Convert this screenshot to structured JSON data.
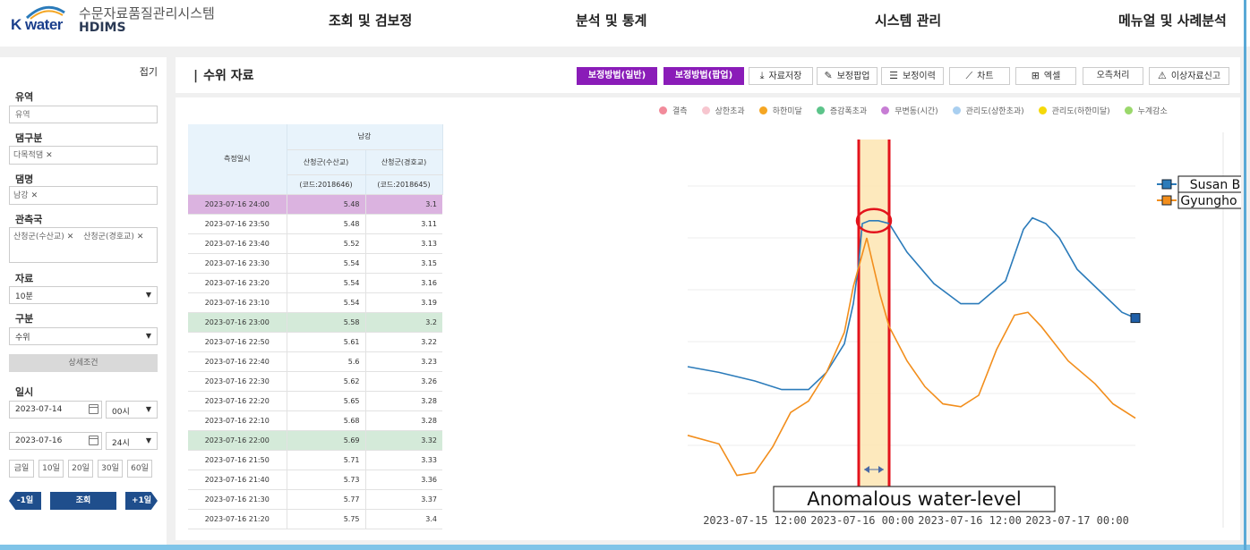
{
  "header": {
    "logo_text": "K water",
    "system_name": "수문자료품질관리시스템",
    "system_abbr": "HDIMS",
    "nav": [
      "조회 및 검보정",
      "분석 및 통계",
      "시스템 관리",
      "메뉴얼 및 사례분석"
    ]
  },
  "sidebar": {
    "fold_label": "접기",
    "basin": {
      "label": "유역",
      "placeholder": "유역"
    },
    "dam_type": {
      "label": "댐구분",
      "tags": [
        "다목적댐"
      ]
    },
    "dam_name": {
      "label": "댐명",
      "tags": [
        "남강"
      ]
    },
    "stations": {
      "label": "관측국",
      "tags": [
        "산청군(수산교)",
        "산청군(경호교)"
      ]
    },
    "data": {
      "label": "자료",
      "value": "10분"
    },
    "category": {
      "label": "구분",
      "value": "수위"
    },
    "detail_button": "상세조건",
    "datetime": {
      "label": "일시",
      "start_date": "2023-07-14",
      "start_hour": "00시",
      "end_date": "2023-07-16",
      "end_hour": "24시"
    },
    "quick": [
      "금일",
      "10일",
      "20일",
      "30일",
      "60일"
    ],
    "prev_day": "-1일",
    "query": "조회",
    "next_day": "+1일"
  },
  "main": {
    "title": "수위 자료",
    "toolbar": [
      {
        "label": "보정방법(일반)",
        "style": "primary",
        "icon": ""
      },
      {
        "label": "보정방법(팝업)",
        "style": "primary",
        "icon": ""
      },
      {
        "label": "자료저장",
        "icon": "download-icon",
        "glyph": "⤓"
      },
      {
        "label": "보정팝업",
        "icon": "edit-icon",
        "glyph": "✎"
      },
      {
        "label": "보정이력",
        "icon": "history-icon",
        "glyph": "☰"
      },
      {
        "label": "차트",
        "icon": "chart-icon",
        "glyph": "⟋"
      },
      {
        "label": "엑셀",
        "icon": "excel-icon",
        "glyph": "⊞"
      },
      {
        "label": "오측처리",
        "icon": "",
        "glyph": ""
      },
      {
        "label": "이상자료신고",
        "icon": "alarm-icon",
        "glyph": "⚠"
      }
    ],
    "legend": [
      {
        "label": "결측",
        "color": "#f28b9b"
      },
      {
        "label": "상한초과",
        "color": "#f7c6cf"
      },
      {
        "label": "하한미달",
        "color": "#f5a623"
      },
      {
        "label": "증감폭초과",
        "color": "#5cc48a"
      },
      {
        "label": "무변동(시간)",
        "color": "#c77dd4"
      },
      {
        "label": "관리도(상한초과)",
        "color": "#a9cff0"
      },
      {
        "label": "관리도(하한미달)",
        "color": "#f5d90a"
      },
      {
        "label": "누계감소",
        "color": "#9ad86b"
      }
    ],
    "table": {
      "col_time": "측정일시",
      "group": "남강",
      "col_a": "산청군(수산교)",
      "col_a_code": "(코드:2018646)",
      "col_b": "산청군(경호교)",
      "col_b_code": "(코드:2018645)",
      "rows": [
        {
          "t": "2023-07-16 24:00",
          "a": "5.48",
          "b": "3.1",
          "flag": "purple"
        },
        {
          "t": "2023-07-16 23:50",
          "a": "5.48",
          "b": "3.11",
          "flag": ""
        },
        {
          "t": "2023-07-16 23:40",
          "a": "5.52",
          "b": "3.13",
          "flag": ""
        },
        {
          "t": "2023-07-16 23:30",
          "a": "5.54",
          "b": "3.15",
          "flag": ""
        },
        {
          "t": "2023-07-16 23:20",
          "a": "5.54",
          "b": "3.16",
          "flag": ""
        },
        {
          "t": "2023-07-16 23:10",
          "a": "5.54",
          "b": "3.19",
          "flag": ""
        },
        {
          "t": "2023-07-16 23:00",
          "a": "5.58",
          "b": "3.2",
          "flag": "green"
        },
        {
          "t": "2023-07-16 22:50",
          "a": "5.61",
          "b": "3.22",
          "flag": ""
        },
        {
          "t": "2023-07-16 22:40",
          "a": "5.6",
          "b": "3.23",
          "flag": ""
        },
        {
          "t": "2023-07-16 22:30",
          "a": "5.62",
          "b": "3.26",
          "flag": ""
        },
        {
          "t": "2023-07-16 22:20",
          "a": "5.65",
          "b": "3.28",
          "flag": ""
        },
        {
          "t": "2023-07-16 22:10",
          "a": "5.68",
          "b": "3.28",
          "flag": ""
        },
        {
          "t": "2023-07-16 22:00",
          "a": "5.69",
          "b": "3.32",
          "flag": "green"
        },
        {
          "t": "2023-07-16 21:50",
          "a": "5.71",
          "b": "3.33",
          "flag": ""
        },
        {
          "t": "2023-07-16 21:40",
          "a": "5.73",
          "b": "3.36",
          "flag": ""
        },
        {
          "t": "2023-07-16 21:30",
          "a": "5.77",
          "b": "3.37",
          "flag": ""
        },
        {
          "t": "2023-07-16 21:20",
          "a": "5.75",
          "b": "3.4",
          "flag": ""
        }
      ]
    }
  },
  "chart_data": {
    "type": "line",
    "x_ticks": [
      "2023-07-15 12:00",
      "2023-07-16 00:00",
      "2023-07-16 12:00",
      "2023-07-17 00:00"
    ],
    "grid": true,
    "legend_position": "right",
    "annotation": "Anomalous water-level",
    "anomaly_window_hours": [
      -0.4,
      3.0
    ],
    "series": [
      {
        "name": "Susan Bridge",
        "color": "#2b7bba",
        "points": [
          [
            -19.5,
            0.3
          ],
          [
            -16,
            0.28
          ],
          [
            -12,
            0.25
          ],
          [
            -9,
            0.22
          ],
          [
            -6,
            0.22
          ],
          [
            -4,
            0.28
          ],
          [
            -2,
            0.38
          ],
          [
            -1,
            0.52
          ],
          [
            -0.4,
            0.66
          ],
          [
            0,
            0.8
          ],
          [
            0.8,
            0.81
          ],
          [
            1.8,
            0.81
          ],
          [
            3.0,
            0.8
          ],
          [
            5,
            0.7
          ],
          [
            8,
            0.59
          ],
          [
            11,
            0.52
          ],
          [
            13,
            0.52
          ],
          [
            16,
            0.6
          ],
          [
            18,
            0.78
          ],
          [
            19,
            0.82
          ],
          [
            20.5,
            0.8
          ],
          [
            22,
            0.75
          ],
          [
            24,
            0.64
          ],
          [
            27,
            0.55
          ],
          [
            29,
            0.49
          ],
          [
            30.5,
            0.47
          ]
        ]
      },
      {
        "name": "Gyungho Bridge",
        "color": "#f28e1c",
        "points": [
          [
            -19.5,
            0.06
          ],
          [
            -16,
            0.03
          ],
          [
            -14,
            -0.08
          ],
          [
            -12,
            -0.07
          ],
          [
            -10,
            0.02
          ],
          [
            -8,
            0.14
          ],
          [
            -6,
            0.18
          ],
          [
            -4,
            0.28
          ],
          [
            -2,
            0.42
          ],
          [
            -1,
            0.58
          ],
          [
            0.5,
            0.75
          ],
          [
            2,
            0.55
          ],
          [
            3,
            0.44
          ],
          [
            5,
            0.32
          ],
          [
            7,
            0.23
          ],
          [
            9,
            0.17
          ],
          [
            11,
            0.16
          ],
          [
            13,
            0.2
          ],
          [
            15,
            0.36
          ],
          [
            17,
            0.48
          ],
          [
            18.5,
            0.49
          ],
          [
            20,
            0.44
          ],
          [
            23,
            0.32
          ],
          [
            26,
            0.24
          ],
          [
            28,
            0.17
          ],
          [
            30.5,
            0.12
          ]
        ]
      }
    ]
  }
}
